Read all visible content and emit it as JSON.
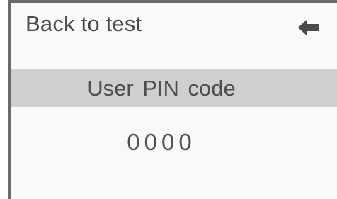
{
  "header": {
    "back_label": "Back to test",
    "back_icon": "arrow-left-icon"
  },
  "title": {
    "text": "User PIN code"
  },
  "pin": {
    "value": "0000"
  },
  "colors": {
    "border": "#6b6b6b",
    "title_band": "#cfcfcf",
    "text": "#4a4a4a",
    "background": "#f9f9f9"
  }
}
